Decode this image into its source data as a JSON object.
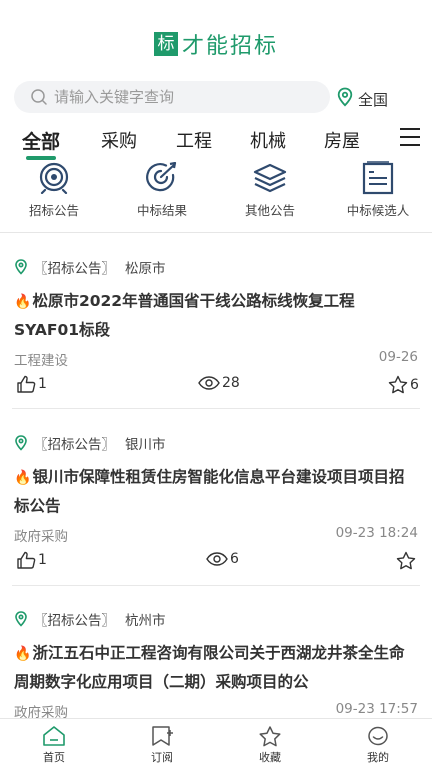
{
  "header": {
    "logo_mark": "标",
    "app_name": "才能招标"
  },
  "search": {
    "placeholder": "请输入关键字查询",
    "location": "全国"
  },
  "tabs": [
    {
      "label": "全部",
      "active": true
    },
    {
      "label": "采购",
      "active": false
    },
    {
      "label": "工程",
      "active": false
    },
    {
      "label": "机械",
      "active": false
    },
    {
      "label": "房屋",
      "active": false
    }
  ],
  "quick_entries": [
    {
      "label": "招标公告",
      "icon": "target-icon"
    },
    {
      "label": "中标结果",
      "icon": "target-arrow-icon"
    },
    {
      "label": "其他公告",
      "icon": "layers-icon"
    },
    {
      "label": "中标候选人",
      "icon": "document-list-icon"
    }
  ],
  "cards": [
    {
      "type": "〖招标公告〗",
      "city": "松原市",
      "title": "松原市2022年普通国省干线公路标线恢复工程SYAF01标段",
      "category": "工程建设",
      "date": "09-26",
      "likes": "1",
      "views": "28",
      "favorites": "6"
    },
    {
      "type": "〖招标公告〗",
      "city": "银川市",
      "title": "银川市保障性租赁住房智能化信息平台建设项目项目招标公告",
      "category": "政府采购",
      "date": "09-23 18:24",
      "likes": "1",
      "views": "6",
      "favorites": ""
    },
    {
      "type": "〖招标公告〗",
      "city": "杭州市",
      "title": "浙江五石中正工程咨询有限公司关于西湖龙井茶全生命周期数字化应用项目（二期）采购项目的公",
      "category": "政府采购",
      "date": "09-23 17:57",
      "likes": "",
      "views": "",
      "favorites": ""
    }
  ],
  "bottom_nav": [
    {
      "label": "首页",
      "icon": "home-icon"
    },
    {
      "label": "订阅",
      "icon": "subscribe-icon"
    },
    {
      "label": "收藏",
      "icon": "star-icon"
    },
    {
      "label": "我的",
      "icon": "profile-icon"
    }
  ],
  "colors": {
    "accent": "#1f9a6b",
    "hot": "#e5322d",
    "icon_blue": "#2f4a6e"
  }
}
